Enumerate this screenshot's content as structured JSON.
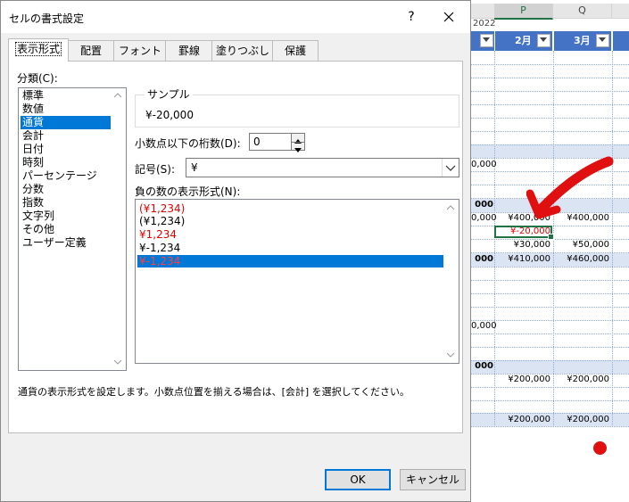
{
  "sheet": {
    "columns": [
      {
        "name": "",
        "selected": false
      },
      {
        "name": "P",
        "selected": true
      },
      {
        "name": "Q",
        "selected": false
      }
    ],
    "year_label": "2022",
    "header_cells": [
      "",
      "2月",
      "3月"
    ],
    "rows": {
      "r1": [
        "0,000",
        "",
        ""
      ],
      "r2": [
        "000",
        "",
        ""
      ],
      "r3": [
        "0,000",
        "¥400,000",
        "¥400,000"
      ],
      "r4": [
        "",
        "¥-20,000",
        ""
      ],
      "r5": [
        "",
        "¥30,000",
        "¥50,000"
      ],
      "r6": [
        "000",
        "¥410,000",
        "¥460,000"
      ],
      "r7": [
        "0,000",
        "",
        ""
      ],
      "r8": [
        "000",
        "",
        ""
      ],
      "r9": [
        "",
        "¥200,000",
        "¥200,000"
      ],
      "r10": [
        "",
        "¥200,000",
        "¥200,000"
      ]
    }
  },
  "dialog": {
    "title": "セルの書式設定",
    "help_label": "?",
    "tabs": [
      "表示形式",
      "配置",
      "フォント",
      "罫線",
      "塗りつぶし",
      "保護"
    ],
    "category_label": "分類(C):",
    "categories": [
      "標準",
      "数値",
      "通貨",
      "会計",
      "日付",
      "時刻",
      "パーセンテージ",
      "分数",
      "指数",
      "文字列",
      "その他",
      "ユーザー定義"
    ],
    "selected_category": "通貨",
    "sample_label": "サンプル",
    "sample_value": "¥-20,000",
    "decimal_label": "小数点以下の桁数(D):",
    "decimal_value": "0",
    "symbol_label": "記号(S):",
    "symbol_value": "¥",
    "negative_label": "負の数の表示形式(N):",
    "negative_formats": [
      {
        "text": "(¥1,234)",
        "red": true
      },
      {
        "text": "(¥1,234)",
        "red": false
      },
      {
        "text": "¥1,234",
        "red": true
      },
      {
        "text": "¥-1,234",
        "red": false
      },
      {
        "text": "¥-1,234",
        "red": true
      }
    ],
    "description": "通貨の表示形式を設定します。小数点位置を揃える場合は、[会計] を選択してください。",
    "ok_label": "OK",
    "cancel_label": "キャンセル"
  },
  "colors": {
    "accent": "#0078d7",
    "table_header": "#4472c4",
    "band": "#dbe4f3",
    "annotation_red": "#e01010",
    "excel_green": "#217346"
  }
}
